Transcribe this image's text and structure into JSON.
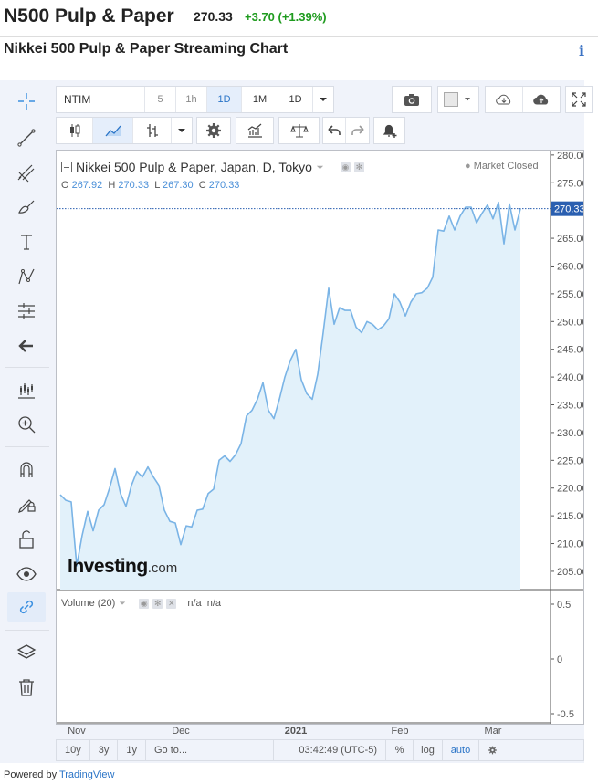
{
  "header": {
    "symbol": "N500 Pulp & Paper",
    "price": "270.33",
    "change": "+3.70 (+1.39%)",
    "subtitle": "Nikkei 500 Pulp & Paper Streaming Chart",
    "info_icon": "i",
    "colors": {
      "positive": "#1e9b1e",
      "link": "#3c73c4"
    }
  },
  "left_toolbar": {
    "tools": [
      "crosshair-icon",
      "trend-line-icon",
      "pitchfork-icon",
      "brush-icon",
      "text-icon",
      "pattern-icon",
      "measure-icon",
      "back-arrow-icon",
      "candles-zoom-icon",
      "zoom-in-icon",
      "magnet-icon",
      "pencil-lock-icon",
      "unlock-icon",
      "eye-icon",
      "link-icon",
      "layers-icon",
      "trash-icon"
    ],
    "active": "link-icon"
  },
  "toolbar1": {
    "symbol_field": "NTIM",
    "intervals": [
      "5",
      "1h",
      "1D",
      "1M",
      "1D"
    ],
    "selected_interval": "1D"
  },
  "chart_legend": {
    "title": "Nikkei 500 Pulp & Paper, Japan, D, Tokyo",
    "open_label": "O",
    "open": "267.92",
    "high_label": "H",
    "high": "270.33",
    "low_label": "L",
    "low": "267.30",
    "close_label": "C",
    "close": "270.33",
    "status": "Market Closed",
    "volume_label": "Volume (20)",
    "volume_values": "n/a  n/a",
    "watermark_brand": "Investing",
    "watermark_domain": ".com"
  },
  "bottom_bar": {
    "ranges": [
      "10y",
      "3y",
      "1y"
    ],
    "goto": "Go to...",
    "time": "03:42:49 (UTC-5)",
    "percent": "%",
    "log": "log",
    "auto": "auto"
  },
  "footer": {
    "powered_by": "Powered by",
    "tradingview": "TradingView"
  },
  "chart_data": {
    "type": "area",
    "title": "Nikkei 500 Pulp & Paper, Japan, D, Tokyo",
    "price_axis": {
      "ticks": [
        280,
        275,
        270,
        265,
        260,
        255,
        250,
        245,
        240,
        235,
        230,
        225,
        220,
        215,
        210,
        205
      ],
      "ylim": [
        201.7,
        280.8
      ]
    },
    "volume_axis": {
      "ticks": [
        0.5,
        0,
        -0.5
      ]
    },
    "x_ticks": [
      {
        "label": "Nov",
        "index": 3
      },
      {
        "label": "Dec",
        "index": 22
      },
      {
        "label": "2021",
        "index": 43
      },
      {
        "label": "Feb",
        "index": 62
      },
      {
        "label": "Mar",
        "index": 79
      }
    ],
    "last_price": 270.33,
    "series": [
      {
        "values": [
          218.8,
          217.8,
          217.5,
          206.0,
          211.5,
          215.8,
          212.3,
          216.0,
          217.0,
          220.0,
          223.5,
          219.0,
          216.7,
          220.5,
          223.0,
          222.0,
          223.8,
          222.0,
          220.5,
          216.0,
          214.0,
          213.7,
          209.8,
          213.2,
          213.0,
          216.0,
          216.2,
          219.0,
          219.8,
          225.0,
          225.8,
          224.8,
          226.0,
          228.0,
          233.0,
          234.0,
          236.0,
          239.0,
          234.0,
          232.5,
          236.0,
          240.0,
          243.0,
          245.0,
          239.5,
          237.0,
          236.0,
          240.5,
          248.0,
          256.0,
          249.5,
          252.5,
          252.0,
          252.0,
          249.0,
          248.0,
          250.0,
          249.5,
          248.5,
          249.2,
          250.5,
          255.0,
          253.5,
          251.0,
          253.5,
          255.0,
          255.2,
          256.0,
          258.0,
          266.5,
          266.3,
          269.0,
          266.5,
          269.0,
          270.6,
          270.6,
          267.8,
          269.5,
          271.0,
          268.5,
          271.5,
          264.0,
          271.2,
          266.5,
          270.3
        ],
        "line_color": "#7ab4e6",
        "fill_color": "#e2f1fa"
      }
    ]
  }
}
